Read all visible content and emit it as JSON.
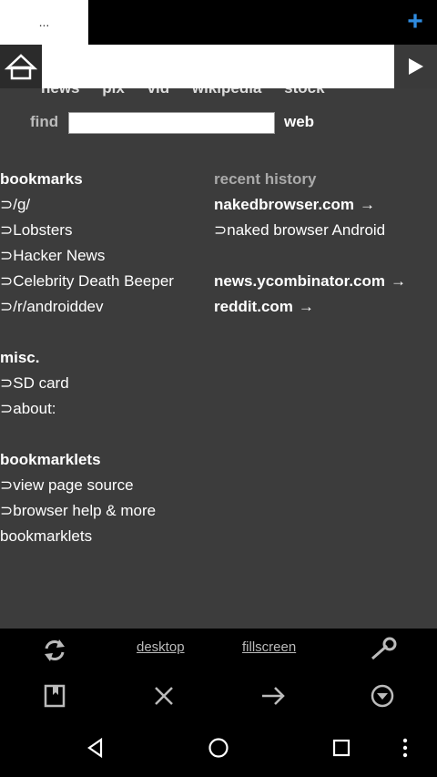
{
  "tabs": {
    "active_label": "..."
  },
  "toolbar_top": {
    "add_icon": "plus-icon",
    "accent": "#2f8ce0"
  },
  "address": {
    "value": "",
    "home_icon": "home-icon",
    "go_icon": "play-icon"
  },
  "quicklinks": [
    "news",
    "pix",
    "vid",
    "wikipedia",
    "stock"
  ],
  "search": {
    "label": "find",
    "value": "",
    "button": "web"
  },
  "bookmarks": {
    "title": "bookmarks",
    "items": [
      "/g/",
      "Lobsters",
      "Hacker News",
      "Celebrity Death Beeper",
      "/r/androiddev"
    ]
  },
  "misc": {
    "title": "misc.",
    "items": [
      "SD card",
      "about:"
    ]
  },
  "bookmarklets": {
    "title": "bookmarklets",
    "items": [
      "view page source",
      "browser help & more"
    ],
    "tail": "bookmarklets"
  },
  "history": {
    "title": "recent history",
    "entries": [
      {
        "domain": "nakedbrowser.com",
        "arrow": "→"
      },
      {
        "page": "naked browser Android"
      },
      {
        "domain": "news.ycombinator.com",
        "arrow": "→"
      },
      {
        "domain": "reddit.com",
        "arrow": "→"
      }
    ]
  },
  "link_prefix": "⊃",
  "bottom": {
    "desktop": "desktop",
    "fillscreen": "fillscreen"
  }
}
